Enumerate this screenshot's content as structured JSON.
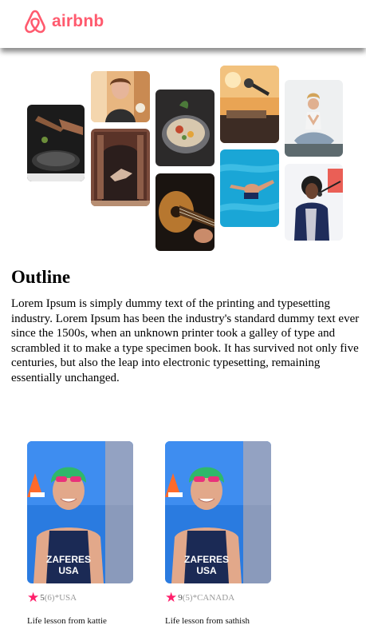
{
  "header": {
    "brand": "airbnb",
    "logo_icon": "airbnb-belo-icon",
    "brand_color": "#ff5a6e"
  },
  "gallery": {
    "photos": [
      {
        "subject": "cooking-pan"
      },
      {
        "subject": "woman-smiling"
      },
      {
        "subject": "archway-dancer"
      },
      {
        "subject": "food-bowl"
      },
      {
        "subject": "acoustic-guitar"
      },
      {
        "subject": "microphone-stage"
      },
      {
        "subject": "swimmer-pool"
      },
      {
        "subject": "yoga-meditation"
      },
      {
        "subject": "singer-microphone"
      }
    ]
  },
  "outline": {
    "title": "Outline",
    "body": "Lorem Ipsum is simply dummy text of the printing and typesetting industry. Lorem Ipsum has been the industry's standard dummy text ever since the 1500s, when an unknown printer took a galley of type and scrambled it to make a type specimen book. It has survived not only five centuries, but also the leap into electronic typesetting, remaining essentially unchanged."
  },
  "experiences": [
    {
      "score": "5",
      "reviews": "(6)",
      "country": "*USA",
      "title": "Life lesson from kattie",
      "jersey": [
        "ZAFERES",
        "USA"
      ]
    },
    {
      "score": "9",
      "reviews": "(5)",
      "country": "*CANADA",
      "title": "Life lesson from sathish",
      "jersey": [
        "ZAFERES",
        "USA"
      ]
    }
  ],
  "colors": {
    "star": "#ff1f6b",
    "rating_text": "#999999"
  }
}
